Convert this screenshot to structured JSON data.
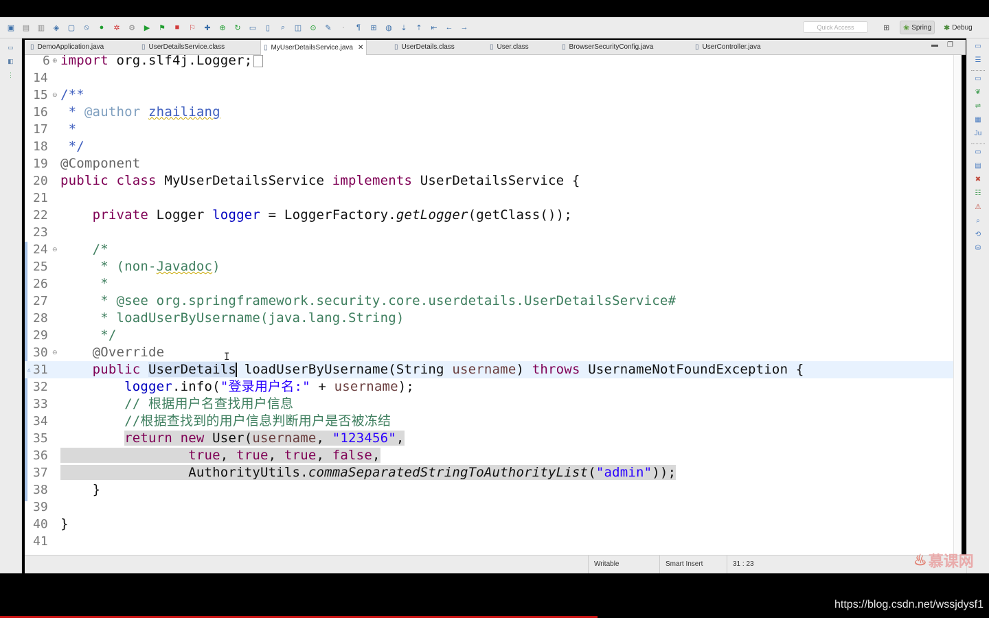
{
  "toolbar": {
    "quick_access_placeholder": "Quick Access",
    "perspectives": [
      {
        "label": "Spring",
        "selected": true
      },
      {
        "label": "Debug",
        "selected": false
      }
    ]
  },
  "tabs": [
    {
      "label": "DemoApplication.java",
      "active": false
    },
    {
      "label": "UserDetailsService.class",
      "active": false
    },
    {
      "label": "MyUserDetailsService.java",
      "active": true
    },
    {
      "label": "UserDetails.class",
      "active": false
    },
    {
      "label": "User.class",
      "active": false
    },
    {
      "label": "BrowserSecurityConfig.java",
      "active": false
    },
    {
      "label": "UserController.java",
      "active": false
    }
  ],
  "editor": {
    "line_numbers": [
      "6",
      "14",
      "15",
      "16",
      "17",
      "18",
      "19",
      "20",
      "21",
      "22",
      "23",
      "24",
      "25",
      "26",
      "27",
      "28",
      "29",
      "30",
      "31",
      "32",
      "33",
      "34",
      "35",
      "36",
      "37",
      "38",
      "39",
      "40",
      "41"
    ],
    "text": {
      "l6_kw": "import",
      "l6_rest": " org.slf4j.Logger;",
      "l15": "/**",
      "l16_star": " * ",
      "l16_tag": "@author",
      "l16_name": "zhailiang",
      "l17": " *",
      "l18": " */",
      "l19": "@Component",
      "l20_kw1": "public",
      "l20_kw2": "class",
      "l20_name": " MyUserDetailsService ",
      "l20_kw3": "implements",
      "l20_rest": " UserDetailsService {",
      "l22_kw": "private",
      "l22_type": " Logger ",
      "l22_field": "logger",
      "l22_mid": " = LoggerFactory.",
      "l22_method": "getLogger",
      "l22_end": "(getClass());",
      "l24": "/*",
      "l25_star": " * (non-",
      "l25_word": "Javadoc",
      "l25_end": ")",
      "l26": " *",
      "l27": " * @see org.springframework.security.core.userdetails.UserDetailsService#",
      "l28": " * loadUserByUsername(java.lang.String)",
      "l29": " */",
      "l30": "@Override",
      "l31_kw": "public",
      "l31_type": "UserDetails",
      "l31_mid": " loadUserByUsername(String ",
      "l31_param": "username",
      "l31_close": ") ",
      "l31_throws": "throws",
      "l31_end": " UsernameNotFoundException {",
      "l32_field": "logger",
      "l32_mid": ".info(",
      "l32_str": "\"登录用户名:\"",
      "l32_plus": " + ",
      "l32_param": "username",
      "l32_end": ");",
      "l33": "// 根据用户名查找用户信息",
      "l34": "//根据查找到的用户信息判断用户是否被冻结",
      "l35_kw1": "return",
      "l35_kw2": "new",
      "l35_user": " User(",
      "l35_param": "username",
      "l35_comma": ", ",
      "l35_str": "\"123456\"",
      "l35_end": ",",
      "l36_t1": "true",
      "l36_t2": "true",
      "l36_t3": "true",
      "l36_f": "false",
      "l36_sep": ", ",
      "l36_end": ",",
      "l37_cls": "AuthorityUtils.",
      "l37_method": "commaSeparatedStringToAuthorityList",
      "l37_open": "(",
      "l37_str": "\"admin\"",
      "l37_end": "));",
      "l38": "}",
      "l40": "}"
    }
  },
  "status": {
    "writable": "Writable",
    "insert_mode": "Smart Insert",
    "position": "31 : 23"
  },
  "watermark": {
    "brand": "慕课网",
    "url": "https://blog.csdn.net/wssjdysf1"
  },
  "colors": {
    "keyword": "#7f0055",
    "field": "#0000c0",
    "string": "#2a00ff",
    "comment": "#3f7f5f",
    "javadoc": "#3f5fbf",
    "current_line": "#e8f2fe",
    "selection": "#d9d9d9"
  }
}
